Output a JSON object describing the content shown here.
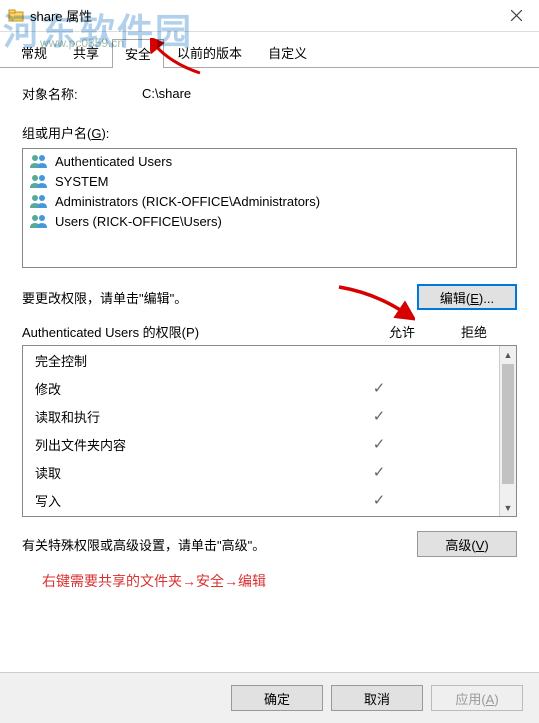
{
  "window": {
    "title": "share 属性"
  },
  "tabs": {
    "items": [
      "常规",
      "共享",
      "安全",
      "以前的版本",
      "自定义"
    ],
    "active_index": 2
  },
  "object": {
    "label": "对象名称:",
    "value": "C:\\share"
  },
  "groups": {
    "label_prefix": "组或用户名(",
    "label_key": "G",
    "label_suffix": "):",
    "items": [
      "Authenticated Users",
      "SYSTEM",
      "Administrators (RICK-OFFICE\\Administrators)",
      "Users (RICK-OFFICE\\Users)"
    ]
  },
  "edit": {
    "hint": "要更改权限，请单击\"编辑\"。",
    "button_prefix": "编辑(",
    "button_key": "E",
    "button_suffix": ")..."
  },
  "permissions": {
    "header_prefix": "Authenticated Users 的权限(",
    "header_key": "P",
    "header_suffix": ")",
    "allow": "允许",
    "deny": "拒绝",
    "rows": [
      {
        "name": "完全控制",
        "allow": false,
        "deny": false
      },
      {
        "name": "修改",
        "allow": true,
        "deny": false
      },
      {
        "name": "读取和执行",
        "allow": true,
        "deny": false
      },
      {
        "name": "列出文件夹内容",
        "allow": true,
        "deny": false
      },
      {
        "name": "读取",
        "allow": true,
        "deny": false
      },
      {
        "name": "写入",
        "allow": true,
        "deny": false
      }
    ]
  },
  "advanced": {
    "hint": "有关特殊权限或高级设置，请单击\"高级\"。",
    "button_prefix": "高级(",
    "button_key": "V",
    "button_suffix": ")"
  },
  "instruction": "右键需要共享的文件夹→安全→编辑",
  "footer": {
    "ok": "确定",
    "cancel": "取消",
    "apply_prefix": "应用(",
    "apply_key": "A",
    "apply_suffix": ")"
  },
  "watermark": {
    "text1": "河东软件园",
    "text2": "www.pc0359.cn"
  }
}
